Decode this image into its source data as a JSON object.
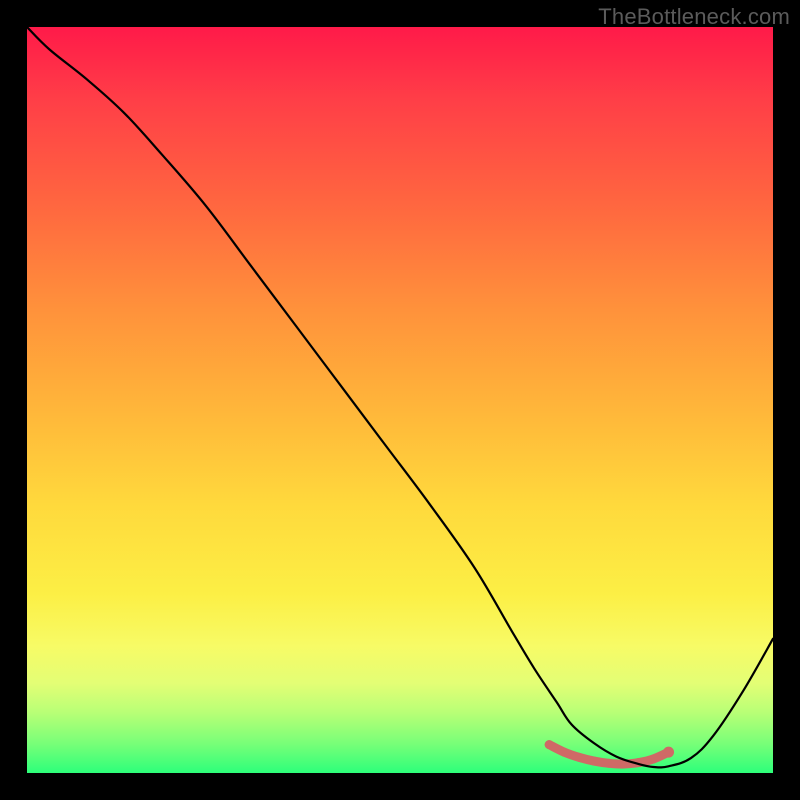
{
  "watermark": "TheBottleneck.com",
  "chart_data": {
    "type": "line",
    "title": "",
    "xlabel": "",
    "ylabel": "",
    "xlim": [
      0,
      100
    ],
    "ylim": [
      0,
      100
    ],
    "series": [
      {
        "name": "curve",
        "x": [
          0,
          3,
          8,
          13,
          18,
          24,
          30,
          36,
          42,
          48,
          54,
          60,
          65,
          68,
          71,
          73,
          76,
          79,
          82,
          84,
          86,
          89,
          92,
          96,
          100
        ],
        "y": [
          100,
          97,
          93,
          88.5,
          83,
          76,
          68,
          60,
          52,
          44,
          36,
          27.5,
          19,
          14,
          9.5,
          6.5,
          4,
          2.2,
          1.2,
          0.8,
          0.9,
          2,
          5,
          11,
          18
        ],
        "color": "#000000",
        "width": 2.2
      },
      {
        "name": "highlight",
        "x": [
          70,
          72,
          74,
          76,
          78,
          80,
          82,
          84,
          86
        ],
        "y": [
          3.8,
          2.8,
          2.1,
          1.6,
          1.3,
          1.2,
          1.4,
          1.9,
          2.8
        ],
        "color": "#cf6a66",
        "width": 9
      }
    ],
    "highlight_dot": {
      "x": 86,
      "y": 2.8,
      "r": 5.5,
      "color": "#cf6a66"
    }
  }
}
